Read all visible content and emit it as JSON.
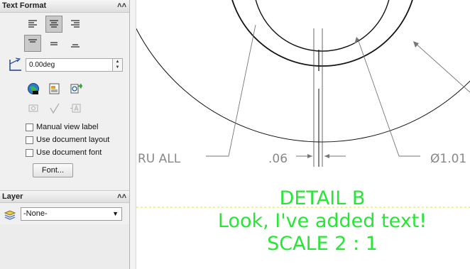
{
  "text_format": {
    "title": "Text Format",
    "angle_value": "0.00deg",
    "manual_view_label": "Manual view label",
    "use_document_layout": "Use document layout",
    "use_document_font": "Use document font",
    "font_button": "Font..."
  },
  "layer": {
    "title": "Layer",
    "selected": "-None-"
  },
  "drawing": {
    "note_line1": "DETAIL B",
    "note_line2": "Look, I've added text!",
    "note_line3": "SCALE 2 : 1",
    "dim_left": "RU ALL",
    "dim_center": ".06",
    "dim_right": "Ø1.01",
    "note_color": "#27e635"
  }
}
